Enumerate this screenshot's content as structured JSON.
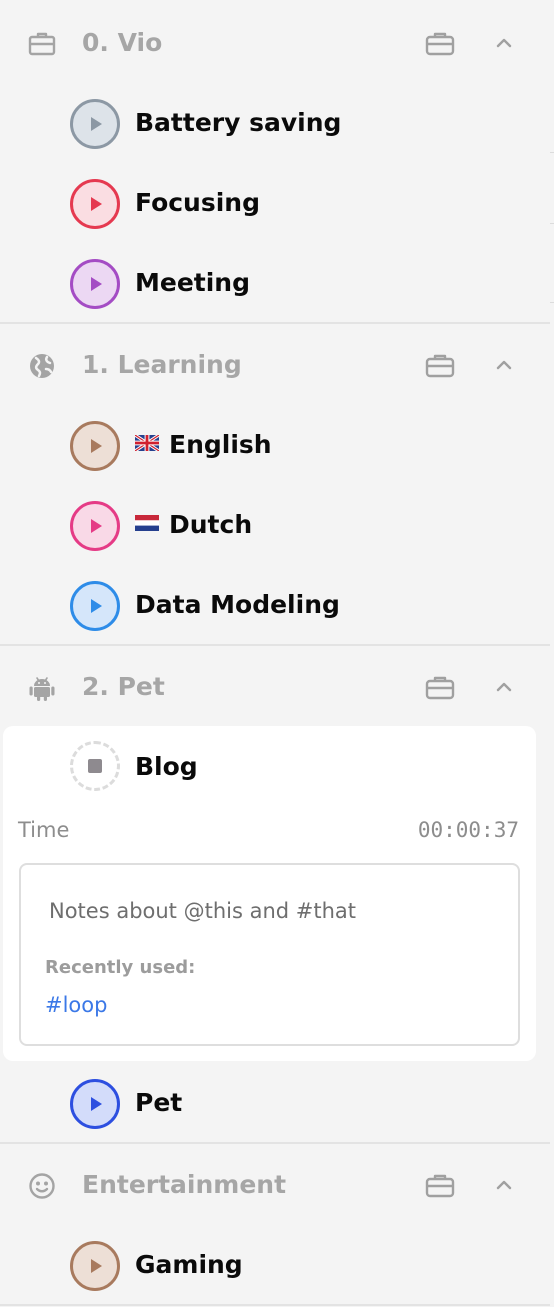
{
  "groups": [
    {
      "title": "0. Vio",
      "icon": "briefcase-icon",
      "tasks": [
        {
          "label": "Battery saving",
          "color": "#8c98a4"
        },
        {
          "label": "Focusing",
          "color": "#e53950"
        },
        {
          "label": "Meeting",
          "color": "#a44cc4"
        }
      ]
    },
    {
      "title": "1. Learning",
      "icon": "globe-icon",
      "tasks": [
        {
          "label": "English",
          "flag": "uk-flag",
          "color": "#a87a5e"
        },
        {
          "label": "Dutch",
          "flag": "netherlands-flag",
          "color": "#e53b86"
        },
        {
          "label": "Data Modeling",
          "color": "#2e8ce8"
        }
      ]
    },
    {
      "title": "2. Pet",
      "icon": "android-icon",
      "active_task": {
        "label": "Blog",
        "time_label": "Time",
        "time_value": "00:00:37",
        "notes_placeholder": "Notes about @this and #that",
        "recent_label": "Recently used:",
        "recent_tags": [
          "#loop"
        ]
      },
      "tasks": [
        {
          "label": "Pet",
          "color": "#2d4fe0"
        }
      ]
    },
    {
      "title": "Entertainment",
      "icon": "smiley-icon",
      "tasks": [
        {
          "label": "Gaming",
          "color": "#a87a5e"
        }
      ]
    }
  ]
}
